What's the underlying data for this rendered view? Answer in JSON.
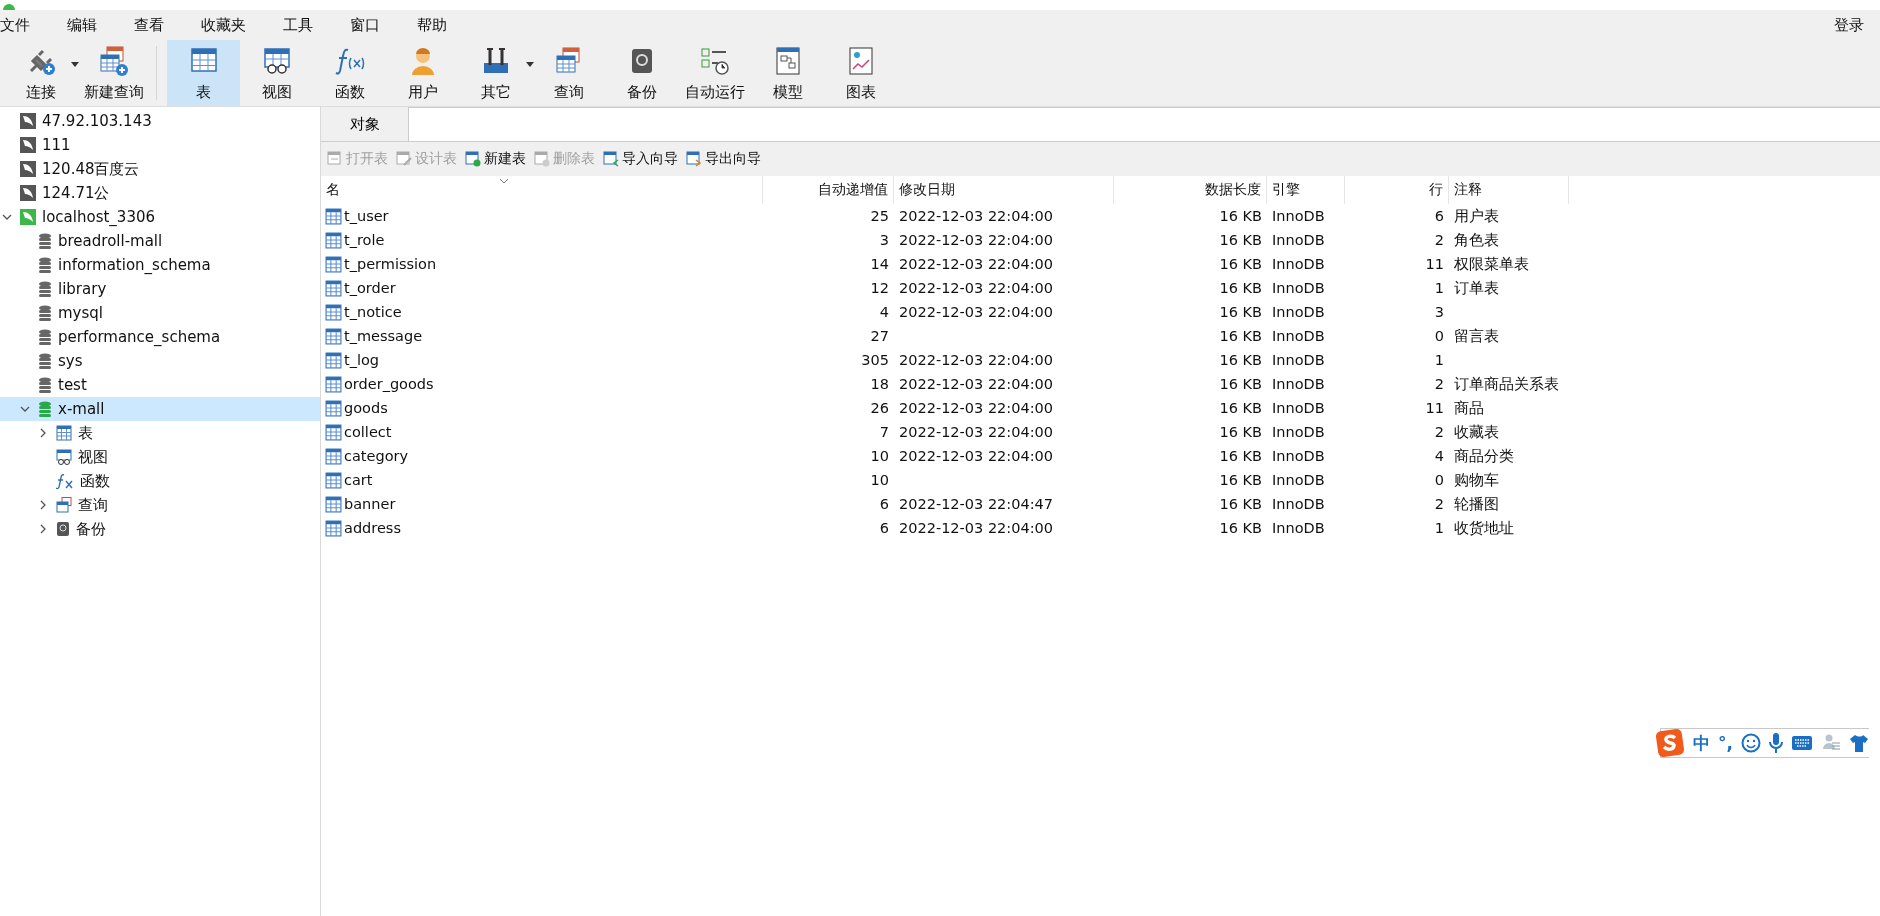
{
  "menu": [
    "文件",
    "编辑",
    "查看",
    "收藏夹",
    "工具",
    "窗口",
    "帮助"
  ],
  "login": "登录",
  "toolbar": [
    {
      "kind": "connect",
      "label": "连接",
      "dropdown": true,
      "selected": false
    },
    {
      "kind": "new_query",
      "label": "新建查询",
      "dropdown": false,
      "selected": false
    },
    {
      "kind": "table",
      "label": "表",
      "dropdown": false,
      "selected": true
    },
    {
      "kind": "view",
      "label": "视图",
      "dropdown": false,
      "selected": false
    },
    {
      "kind": "function",
      "label": "函数",
      "dropdown": false,
      "selected": false
    },
    {
      "kind": "user",
      "label": "用户",
      "dropdown": false,
      "selected": false
    },
    {
      "kind": "other",
      "label": "其它",
      "dropdown": true,
      "selected": false
    },
    {
      "kind": "query",
      "label": "查询",
      "dropdown": false,
      "selected": false
    },
    {
      "kind": "backup",
      "label": "备份",
      "dropdown": false,
      "selected": false
    },
    {
      "kind": "schedule",
      "label": "自动运行",
      "dropdown": false,
      "selected": false
    },
    {
      "kind": "model",
      "label": "模型",
      "dropdown": false,
      "selected": false
    },
    {
      "kind": "chart",
      "label": "图表",
      "dropdown": false,
      "selected": false
    }
  ],
  "sidebar": {
    "items": [
      {
        "kind": "connection",
        "label": "47.92.103.143",
        "open": false,
        "selected": false
      },
      {
        "kind": "connection",
        "label": "111",
        "open": false,
        "selected": false
      },
      {
        "kind": "connection",
        "label": "120.48百度云",
        "open": false,
        "selected": false
      },
      {
        "kind": "connection",
        "label": "124.71公",
        "open": false,
        "selected": false
      },
      {
        "kind": "connection",
        "label": "localhost_3306",
        "open": true,
        "selected": false,
        "expanded": true,
        "children": [
          {
            "kind": "database",
            "label": "breadroll-mall",
            "open": false,
            "selected": false
          },
          {
            "kind": "database",
            "label": "information_schema",
            "open": false,
            "selected": false
          },
          {
            "kind": "database",
            "label": "library",
            "open": false,
            "selected": false
          },
          {
            "kind": "database",
            "label": "mysql",
            "open": false,
            "selected": false
          },
          {
            "kind": "database",
            "label": "performance_schema",
            "open": false,
            "selected": false
          },
          {
            "kind": "database",
            "label": "sys",
            "open": false,
            "selected": false
          },
          {
            "kind": "database",
            "label": "test",
            "open": false,
            "selected": false
          },
          {
            "kind": "database",
            "label": "x-mall",
            "open": true,
            "selected": true,
            "expanded": true,
            "children": [
              {
                "kind": "tables",
                "label": "表",
                "selected": false,
                "expanded": false
              },
              {
                "kind": "views",
                "label": "视图",
                "selected": false
              },
              {
                "kind": "functions",
                "label": "函数",
                "selected": false
              },
              {
                "kind": "queries",
                "label": "查询",
                "selected": false,
                "expanded": false
              },
              {
                "kind": "backups",
                "label": "备份",
                "selected": false,
                "expanded": false
              }
            ]
          }
        ]
      }
    ]
  },
  "tabs": [
    {
      "label": "对象",
      "selected": true
    }
  ],
  "object_toolbar": [
    {
      "kind": "open",
      "label": "打开表",
      "disabled": true
    },
    {
      "kind": "design",
      "label": "设计表",
      "disabled": true
    },
    {
      "kind": "new",
      "label": "新建表",
      "disabled": false
    },
    {
      "kind": "delete",
      "label": "删除表",
      "disabled": true
    },
    {
      "kind": "import",
      "label": "导入向导",
      "disabled": false
    },
    {
      "kind": "export",
      "label": "导出向导",
      "disabled": false
    }
  ],
  "table": {
    "columns": [
      "名",
      "自动递增值",
      "修改日期",
      "数据长度",
      "引擎",
      "行",
      "注释"
    ],
    "rows": [
      {
        "name": "t_user",
        "auto_increment": "25",
        "modified": "2022-12-03 22:04:00",
        "data_length": "16 KB",
        "engine": "InnoDB",
        "rows": "6",
        "comment": "用户表"
      },
      {
        "name": "t_role",
        "auto_increment": "3",
        "modified": "2022-12-03 22:04:00",
        "data_length": "16 KB",
        "engine": "InnoDB",
        "rows": "2",
        "comment": "角色表"
      },
      {
        "name": "t_permission",
        "auto_increment": "14",
        "modified": "2022-12-03 22:04:00",
        "data_length": "16 KB",
        "engine": "InnoDB",
        "rows": "11",
        "comment": "权限菜单表"
      },
      {
        "name": "t_order",
        "auto_increment": "12",
        "modified": "2022-12-03 22:04:00",
        "data_length": "16 KB",
        "engine": "InnoDB",
        "rows": "1",
        "comment": "订单表"
      },
      {
        "name": "t_notice",
        "auto_increment": "4",
        "modified": "2022-12-03 22:04:00",
        "data_length": "16 KB",
        "engine": "InnoDB",
        "rows": "3"
      },
      {
        "name": "t_message",
        "auto_increment": "27",
        "data_length": "16 KB",
        "engine": "InnoDB",
        "rows": "0",
        "comment": "留言表"
      },
      {
        "name": "t_log",
        "auto_increment": "305",
        "modified": "2022-12-03 22:04:00",
        "data_length": "16 KB",
        "engine": "InnoDB",
        "rows": "1"
      },
      {
        "name": "order_goods",
        "auto_increment": "18",
        "modified": "2022-12-03 22:04:00",
        "data_length": "16 KB",
        "engine": "InnoDB",
        "rows": "2",
        "comment": "订单商品关系表"
      },
      {
        "name": "goods",
        "auto_increment": "26",
        "modified": "2022-12-03 22:04:00",
        "data_length": "16 KB",
        "engine": "InnoDB",
        "rows": "11",
        "comment": "商品"
      },
      {
        "name": "collect",
        "auto_increment": "7",
        "modified": "2022-12-03 22:04:00",
        "data_length": "16 KB",
        "engine": "InnoDB",
        "rows": "2",
        "comment": "收藏表"
      },
      {
        "name": "category",
        "auto_increment": "10",
        "modified": "2022-12-03 22:04:00",
        "data_length": "16 KB",
        "engine": "InnoDB",
        "rows": "4",
        "comment": "商品分类"
      },
      {
        "name": "cart",
        "auto_increment": "10",
        "data_length": "16 KB",
        "engine": "InnoDB",
        "rows": "0",
        "comment": "购物车"
      },
      {
        "name": "banner",
        "auto_increment": "6",
        "modified": "2022-12-03 22:04:47",
        "data_length": "16 KB",
        "engine": "InnoDB",
        "rows": "2",
        "comment": "轮播图"
      },
      {
        "name": "address",
        "auto_increment": "6",
        "modified": "2022-12-03 22:04:00",
        "data_length": "16 KB",
        "engine": "InnoDB",
        "rows": "1",
        "comment": "收货地址"
      }
    ]
  },
  "ime_bar": {
    "mode": "中",
    "punctuation": "°,"
  }
}
